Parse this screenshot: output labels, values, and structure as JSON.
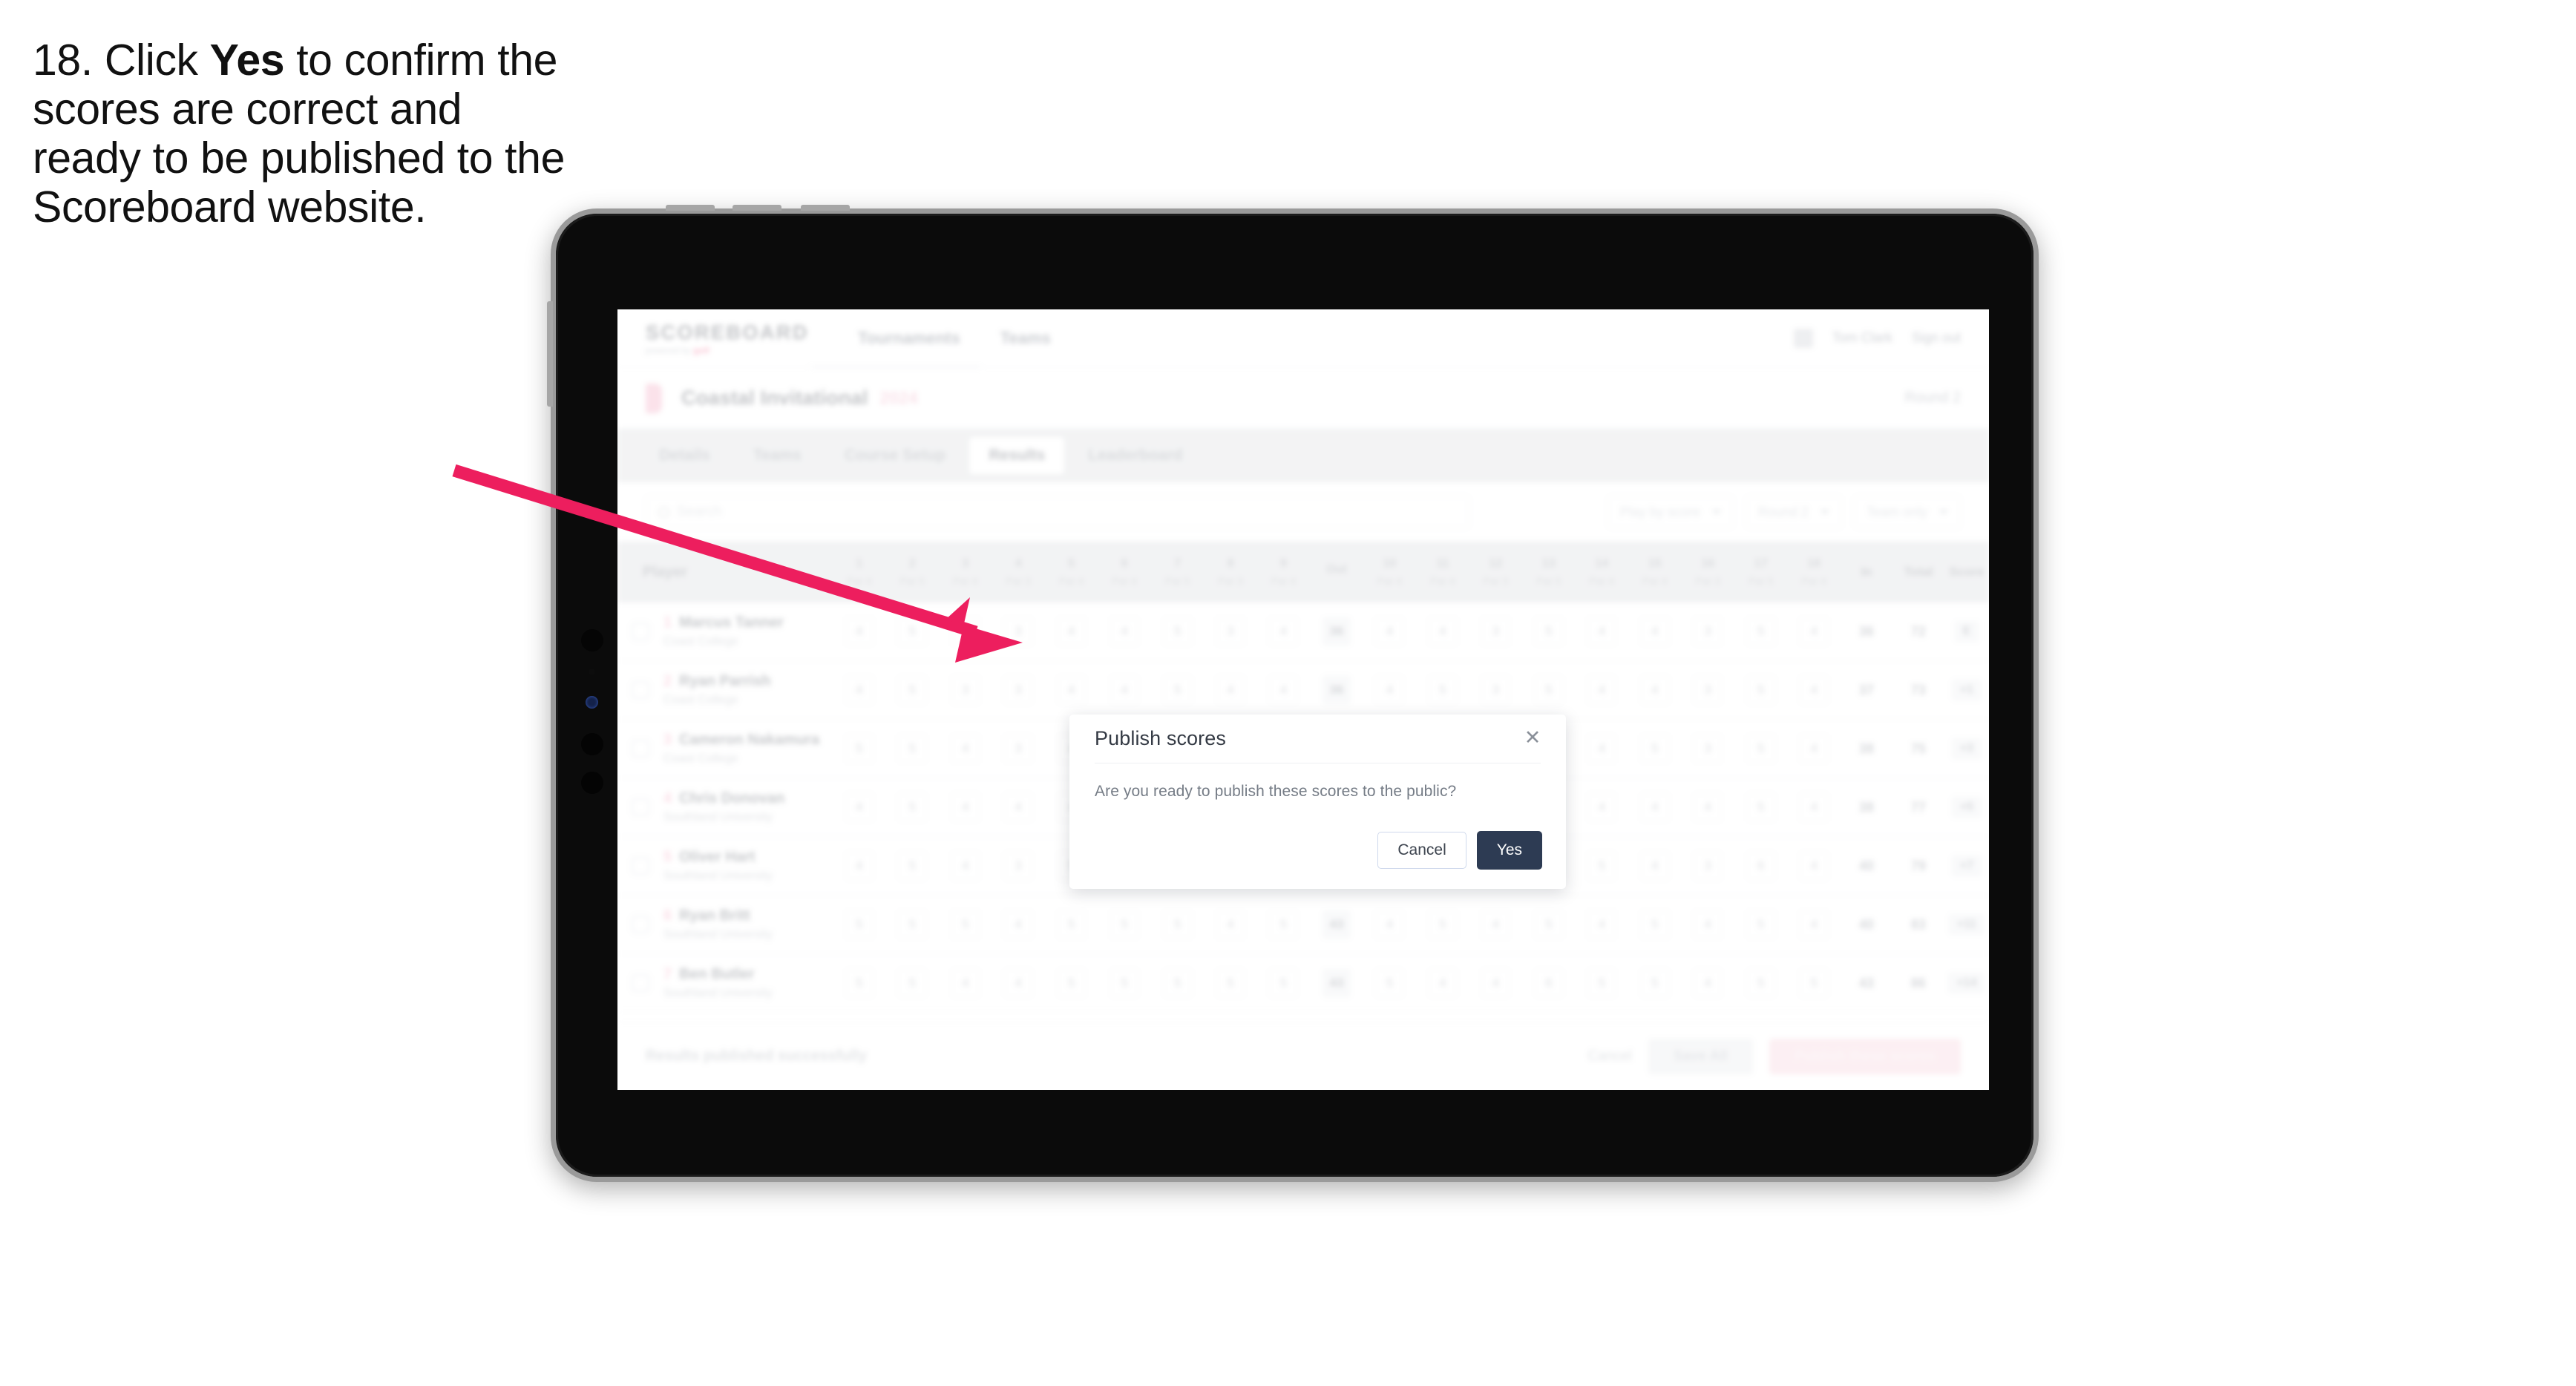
{
  "instruction": {
    "number": "18.",
    "lead": "Click",
    "emphasis": "Yes",
    "rest": "to confirm the scores are correct and ready to be published to the Scoreboard website."
  },
  "annotation": {
    "arrow_color": "#ED1E5E",
    "points_to": "Yes"
  },
  "device": {
    "type": "tablet",
    "frame_color": "#9a9a9a",
    "bezel_color": "#0b0b0b"
  },
  "app": {
    "brand": {
      "name": "SCOREBOARD",
      "tagline_prefix": "powered by",
      "tagline_accent": "golf"
    },
    "topnav": {
      "links": [
        "Tournaments",
        "Teams"
      ],
      "avatar": "avatar-icon",
      "right_links": [
        "Tom Clark",
        "Sign out"
      ]
    },
    "event": {
      "flag_icon": "flag-icon",
      "name": "Coastal Invitational",
      "status": "2024",
      "right_label": "Round 2"
    },
    "tabs": [
      {
        "label": "Details",
        "active": false
      },
      {
        "label": "Teams",
        "active": false
      },
      {
        "label": "Course Setup",
        "active": false
      },
      {
        "label": "Results",
        "active": true
      },
      {
        "label": "Leaderboard",
        "active": false
      }
    ],
    "filters": {
      "search_placeholder": "Search",
      "search_icon": "search-icon",
      "selects": [
        "Play by score",
        "Round 2",
        "Team only"
      ]
    },
    "table": {
      "player_header": "Player",
      "hole_numbers": [
        "1",
        "2",
        "3",
        "4",
        "5",
        "6",
        "7",
        "8",
        "9",
        "Out",
        "10",
        "11",
        "12",
        "13",
        "14",
        "15",
        "16",
        "17",
        "18"
      ],
      "hole_pars": [
        "Par 4",
        "Par 5",
        "Par 4",
        "Par 3",
        "Par 4",
        "Par 4",
        "Par 5",
        "Par 3",
        "Par 4",
        "",
        "Par 4",
        "Par 4",
        "Par 3",
        "Par 5",
        "Par 4",
        "Par 4",
        "Par 3",
        "Par 5",
        "Par 4"
      ],
      "total_headers": [
        "In",
        "Total",
        "Score"
      ],
      "rows": [
        {
          "position": "1",
          "name": "Marcus Tanner",
          "team": "Coast College",
          "scores": [
            "4",
            "5",
            "4",
            "3",
            "4",
            "4",
            "5",
            "3",
            "4",
            "36",
            "4",
            "4",
            "3",
            "5",
            "4",
            "4",
            "3",
            "5",
            "4"
          ],
          "in": "36",
          "total": "72",
          "score": "E",
          "to_par": "72"
        },
        {
          "position": "2",
          "name": "Ryan Parrish",
          "team": "Coast College",
          "scores": [
            "4",
            "5",
            "3",
            "3",
            "4",
            "4",
            "5",
            "4",
            "4",
            "36",
            "4",
            "5",
            "3",
            "5",
            "4",
            "4",
            "3",
            "5",
            "4"
          ],
          "in": "37",
          "total": "73",
          "score": "+1",
          "to_par": "73"
        },
        {
          "position": "3",
          "name": "Cameron Nakamura",
          "team": "Coast College",
          "scores": [
            "5",
            "5",
            "4",
            "3",
            "4",
            "4",
            "5",
            "3",
            "4",
            "37",
            "4",
            "4",
            "4",
            "5",
            "4",
            "5",
            "3",
            "5",
            "4"
          ],
          "in": "38",
          "total": "75",
          "score": "+3",
          "to_par": "75"
        },
        {
          "position": "4",
          "name": "Chris Donovan",
          "team": "Southland University",
          "scores": [
            "4",
            "5",
            "4",
            "4",
            "4",
            "5",
            "5",
            "4",
            "4",
            "39",
            "4",
            "5",
            "3",
            "5",
            "4",
            "4",
            "4",
            "5",
            "4"
          ],
          "in": "38",
          "total": "77",
          "score": "+5",
          "to_par": "77"
        },
        {
          "position": "5",
          "name": "Oliver Hart",
          "team": "Southland University",
          "scores": [
            "4",
            "5",
            "4",
            "3",
            "5",
            "5",
            "4",
            "4",
            "5",
            "39",
            "5",
            "4",
            "4",
            "5",
            "5",
            "4",
            "3",
            "6",
            "4"
          ],
          "in": "40",
          "total": "79",
          "score": "+7",
          "to_par": "79"
        },
        {
          "position": "6",
          "name": "Ryan Britt",
          "team": "Southland University",
          "scores": [
            "5",
            "5",
            "5",
            "4",
            "5",
            "5",
            "5",
            "4",
            "5",
            "43",
            "4",
            "5",
            "4",
            "5",
            "4",
            "5",
            "4",
            "5",
            "4"
          ],
          "in": "40",
          "total": "83",
          "score": "+11",
          "to_par": "83"
        },
        {
          "position": "7",
          "name": "Ben Butler",
          "team": "Southland University",
          "scores": [
            "5",
            "5",
            "4",
            "4",
            "5",
            "5",
            "5",
            "5",
            "5",
            "43",
            "5",
            "4",
            "4",
            "6",
            "5",
            "5",
            "4",
            "5",
            "5"
          ],
          "in": "43",
          "total": "86",
          "score": "+14",
          "to_par": "86"
        }
      ]
    },
    "bottom": {
      "status": "Results published successfully",
      "link": "Cancel",
      "secondary_button": "Save All",
      "primary_button": "Publish these scores"
    }
  },
  "modal": {
    "title": "Publish scores",
    "close_icon": "close-icon",
    "body": "Are you ready to publish these scores to the public?",
    "cancel_label": "Cancel",
    "confirm_label": "Yes",
    "confirm_color": "#2d3b53"
  }
}
